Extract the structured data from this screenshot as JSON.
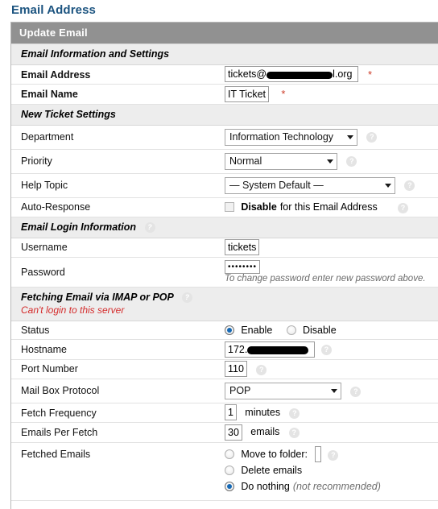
{
  "page": {
    "title": "Email Address"
  },
  "panel": {
    "bar_title": "Update Email"
  },
  "sections": {
    "info": "Email Information and Settings",
    "ticket": "New Ticket Settings",
    "login": "Email Login Information",
    "fetch": "Fetching Email via IMAP or POP",
    "fetch_error": "Can't login to this server"
  },
  "fields": {
    "email_address": {
      "label": "Email Address",
      "value_prefix": "tickets@",
      "value_suffix": "l.org",
      "required_mark": "*"
    },
    "email_name": {
      "label": "Email Name",
      "value": "IT Ticket",
      "required_mark": "*"
    },
    "department": {
      "label": "Department",
      "value": "Information Technology"
    },
    "priority": {
      "label": "Priority",
      "value": "Normal"
    },
    "help_topic": {
      "label": "Help Topic",
      "value": "— System Default —"
    },
    "auto_response": {
      "label": "Auto-Response",
      "option_bold": "Disable",
      "option_rest": "for this Email Address",
      "checked": false
    },
    "username": {
      "label": "Username",
      "value": "tickets"
    },
    "password": {
      "label": "Password",
      "value": "••••••••",
      "hint": "To change password enter new password above."
    },
    "status": {
      "label": "Status",
      "options": [
        "Enable",
        "Disable"
      ],
      "selected": "Enable"
    },
    "hostname": {
      "label": "Hostname",
      "value_prefix": "172."
    },
    "port_number": {
      "label": "Port Number",
      "value": "110"
    },
    "mailbox_protocol": {
      "label": "Mail Box Protocol",
      "value": "POP"
    },
    "fetch_frequency": {
      "label": "Fetch Frequency",
      "value": "1",
      "unit": "minutes"
    },
    "emails_per_fetch": {
      "label": "Emails Per Fetch",
      "value": "30",
      "unit": "emails"
    },
    "fetched_emails": {
      "label": "Fetched Emails",
      "options": [
        {
          "label": "Move to folder:",
          "selected": false,
          "folder_value": ""
        },
        {
          "label": "Delete emails",
          "selected": false
        },
        {
          "label": "Do nothing",
          "note": "(not recommended)",
          "selected": true
        }
      ]
    }
  },
  "icons": {
    "help": "?"
  },
  "colors": {
    "heading": "#1c5480",
    "bar": "#919191",
    "section_bg": "#ededed",
    "error": "#d42b2b",
    "required": "#cc3a27",
    "radio_dot": "#1669b5"
  }
}
